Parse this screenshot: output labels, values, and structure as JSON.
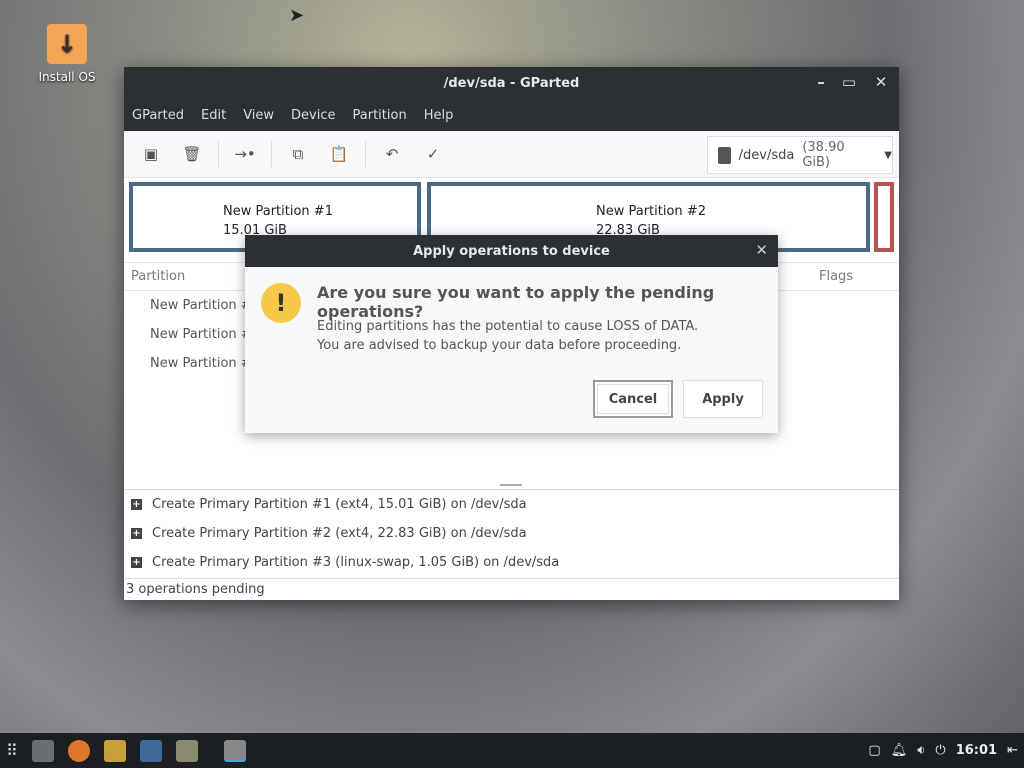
{
  "desktop": {
    "icon_label": "Install OS"
  },
  "window": {
    "title": "/dev/sda - GParted",
    "menu": [
      "GParted",
      "Edit",
      "View",
      "Device",
      "Partition",
      "Help"
    ],
    "device": "/dev/sda",
    "device_size": "(38.90 GiB)",
    "partitions": [
      {
        "name": "New Partition #1",
        "size": "15.01 GiB"
      },
      {
        "name": "New Partition #2",
        "size": "22.83 GiB"
      }
    ],
    "columns": {
      "partition": "Partition",
      "flags": "Flags"
    },
    "rows": [
      "New Partition #",
      "New Partition #",
      "New Partition #"
    ],
    "operations": [
      "Create Primary Partition #1 (ext4, 15.01 GiB) on /dev/sda",
      "Create Primary Partition #2 (ext4, 22.83 GiB) on /dev/sda",
      "Create Primary Partition #3 (linux-swap, 1.05 GiB) on /dev/sda"
    ],
    "status": "3 operations pending"
  },
  "dialog": {
    "title": "Apply operations to device",
    "question": "Are you sure you want to apply the pending operations?",
    "line1": "Editing partitions has the potential to cause LOSS of DATA.",
    "line2": "You are advised to backup your data before proceeding.",
    "cancel": "Cancel",
    "apply": "Apply"
  },
  "taskbar": {
    "clock": "16:01"
  }
}
